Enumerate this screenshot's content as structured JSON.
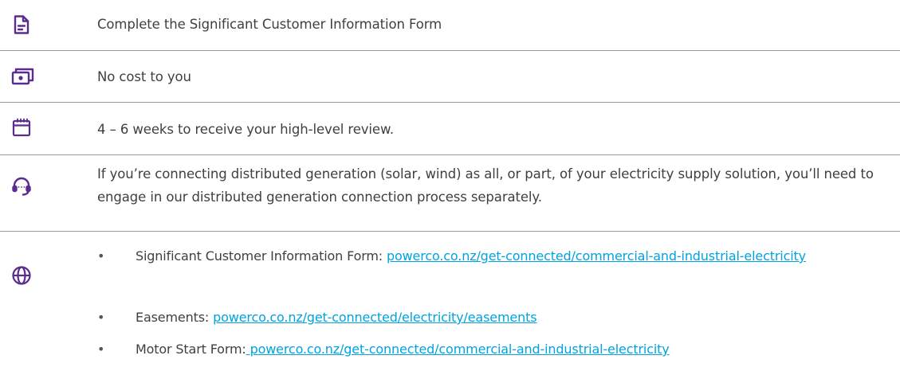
{
  "rows": [
    {
      "icon": "document-form-icon",
      "text": "Complete the Significant Customer Information Form"
    },
    {
      "icon": "cash-money-icon",
      "text": "No cost to you"
    },
    {
      "icon": "calendar-icon",
      "text": "4 – 6 weeks to receive your high-level review."
    },
    {
      "icon": "headset-support-icon",
      "text": "If you’re connecting distributed generation (solar, wind) as all, or part, of your electricity supply solution, you’ll need to engage in our distributed generation connection process separately."
    }
  ],
  "links_row": {
    "icon": "globe-icon",
    "items": [
      {
        "label": "Significant Customer Information Form: ",
        "link_text": "powerco.co.nz/get-connected/commercial-and-industrial-electricity"
      },
      {
        "label": "Easements: ",
        "link_text": "powerco.co.nz/get-connected/electricity/easements"
      },
      {
        "label": "Motor Start Form:",
        "link_text": " powerco.co.nz/get-connected/commercial-and-industrial-electricity"
      }
    ],
    "bullet": "•"
  },
  "colors": {
    "accent": "#5b2c8f",
    "link": "#00a3e0",
    "divider": "#9a9a9a",
    "text": "#3f3f3f"
  }
}
